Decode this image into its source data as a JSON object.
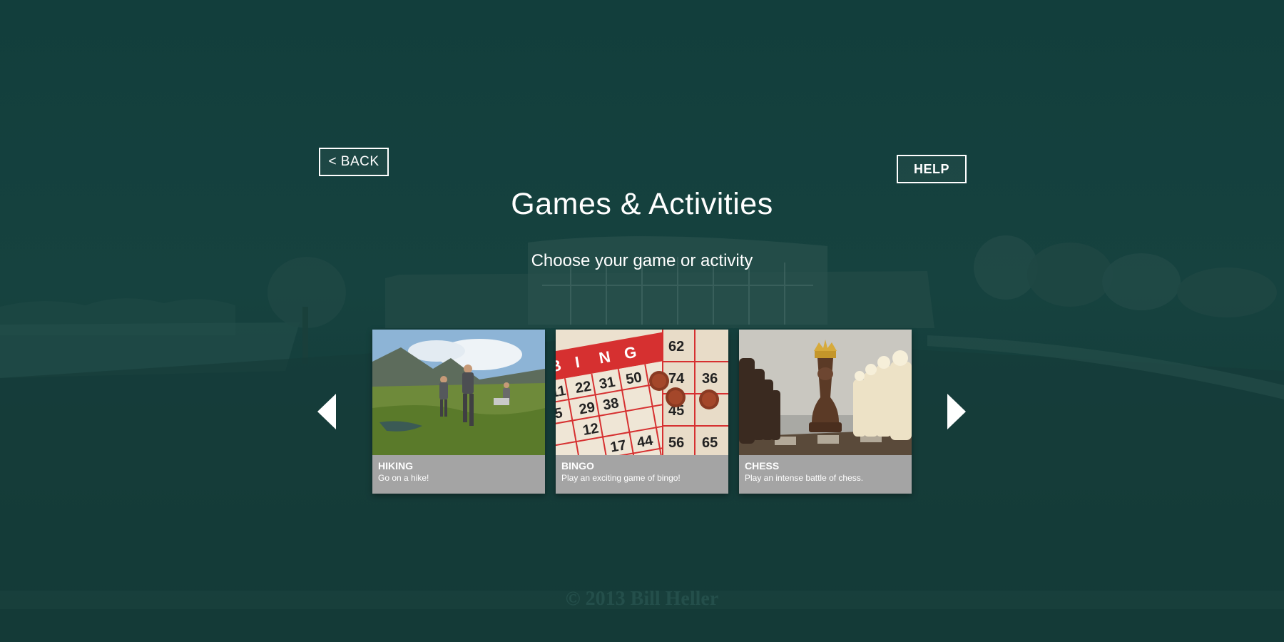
{
  "header": {
    "back_label": "< BACK",
    "help_label": "HELP",
    "title": "Games & Activities",
    "subtitle": "Choose your game or activity"
  },
  "carousel": {
    "prev_icon": "chevron-left-icon",
    "next_icon": "chevron-right-icon",
    "cards": [
      {
        "title": "HIKING",
        "description": "Go on a hike!"
      },
      {
        "title": "BINGO",
        "description": "Play an exciting game of bingo!"
      },
      {
        "title": "CHESS",
        "description": "Play an intense battle of chess."
      }
    ]
  },
  "background": {
    "watermark": "© 2013 Bill Heller"
  },
  "colors": {
    "background": "#123f3d",
    "caption_bg": "#a4a4a4",
    "text": "#ffffff"
  }
}
